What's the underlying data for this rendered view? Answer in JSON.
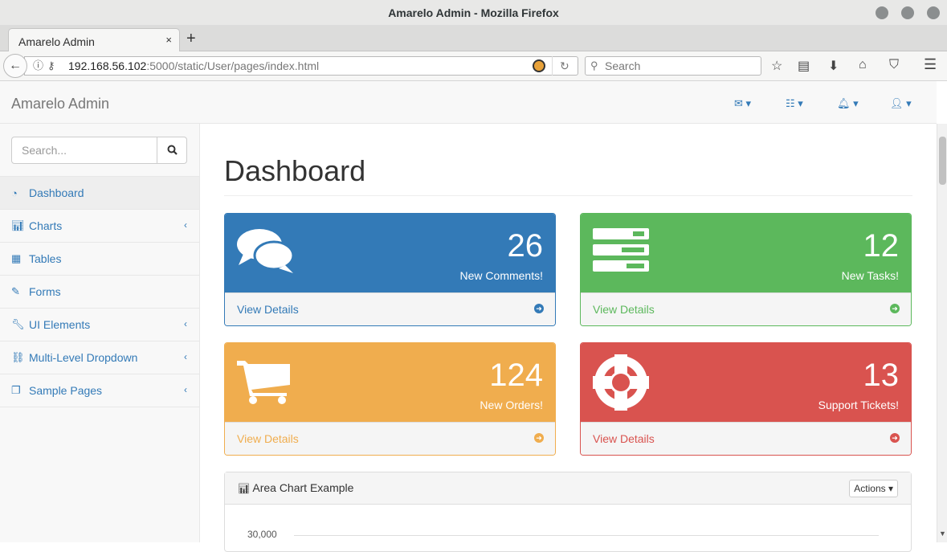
{
  "window": {
    "title": "Amarelo Admin - Mozilla Firefox"
  },
  "browser": {
    "tab_title": "Amarelo Admin",
    "tab_close": "×",
    "new_tab": "+",
    "url_host": "192.168.56.102",
    "url_path": ":5000/static/User/pages/index.html",
    "search_placeholder": "Search"
  },
  "app": {
    "brand": "Amarelo Admin",
    "sidebar": {
      "search_placeholder": "Search...",
      "items": [
        {
          "label": "Dashboard",
          "icon": "dashboard-icon",
          "active": true,
          "has_arrow": false
        },
        {
          "label": "Charts",
          "icon": "bar-chart-icon",
          "has_arrow": true
        },
        {
          "label": "Tables",
          "icon": "table-icon",
          "has_arrow": false
        },
        {
          "label": "Forms",
          "icon": "edit-icon",
          "has_arrow": false
        },
        {
          "label": "UI Elements",
          "icon": "wrench-icon",
          "has_arrow": true
        },
        {
          "label": "Multi-Level Dropdown",
          "icon": "sitemap-icon",
          "has_arrow": true
        },
        {
          "label": "Sample Pages",
          "icon": "files-icon",
          "has_arrow": true
        }
      ]
    },
    "page_title": "Dashboard",
    "panels": [
      {
        "number": "26",
        "label": "New Comments!",
        "footer": "View Details",
        "color": "#337ab7",
        "icon": "comments-icon"
      },
      {
        "number": "12",
        "label": "New Tasks!",
        "footer": "View Details",
        "color": "#5cb85c",
        "icon": "tasks-icon"
      },
      {
        "number": "124",
        "label": "New Orders!",
        "footer": "View Details",
        "color": "#f0ad4e",
        "icon": "shopping-cart-icon"
      },
      {
        "number": "13",
        "label": "Support Tickets!",
        "footer": "View Details",
        "color": "#d9534f",
        "icon": "support-icon"
      }
    ],
    "chart_panel": {
      "title": "Area Chart Example",
      "actions_label": "Actions",
      "y_tick": "30,000"
    }
  }
}
